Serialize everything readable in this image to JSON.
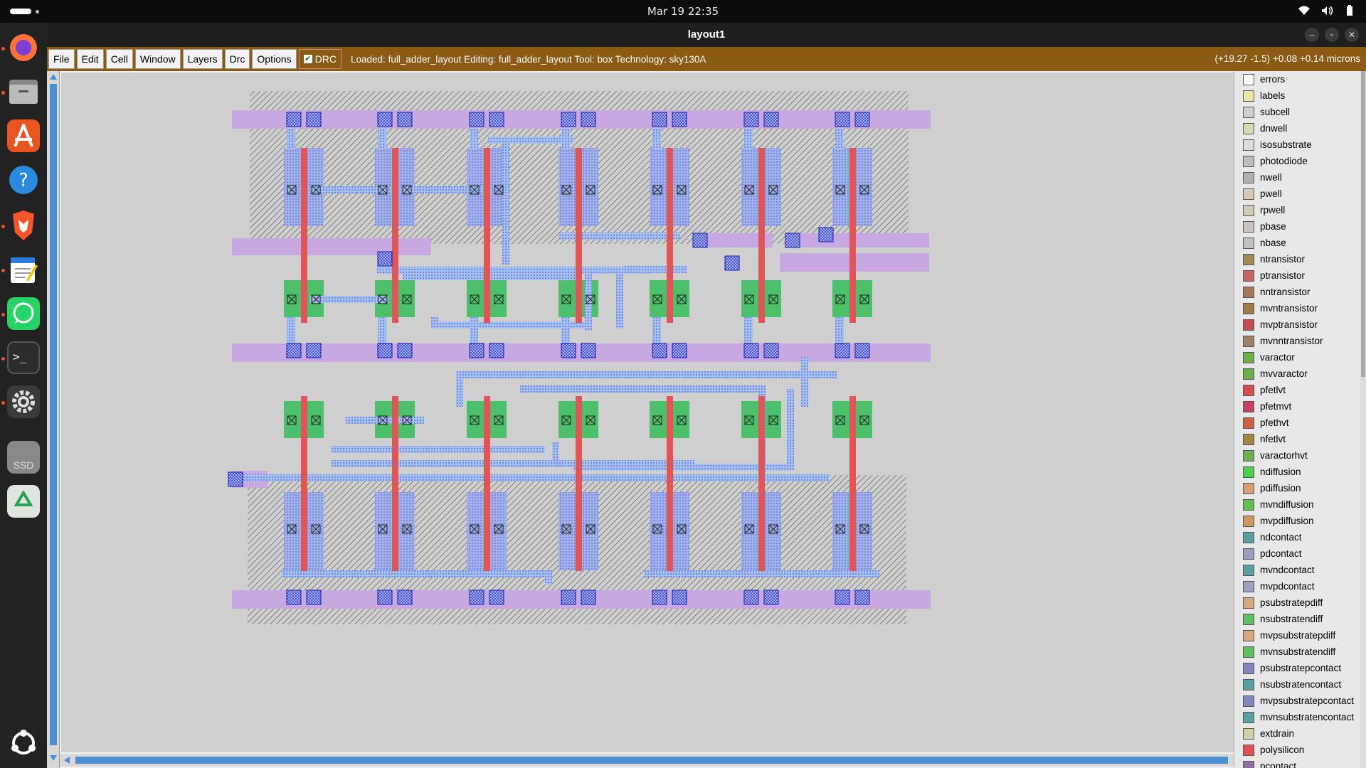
{
  "topbar": {
    "clock": "Mar 19  22:35"
  },
  "window": {
    "title": "layout1",
    "min": "–",
    "max": "▫",
    "close": "✕"
  },
  "menu": {
    "items": [
      "File",
      "Edit",
      "Cell",
      "Window",
      "Layers",
      "Drc",
      "Options"
    ],
    "drc_label": "DRC",
    "status": "Loaded: full_adder_layout  Editing: full_adder_layout  Tool: box   Technology: sky130A",
    "coords": "(+19.27 -1.5) +0.08 +0.14 microns"
  },
  "dock": {
    "ssd": "SSD"
  },
  "legend": [
    {
      "name": "errors",
      "color": "#ffffff"
    },
    {
      "name": "labels",
      "color": "#e8e6a0"
    },
    {
      "name": "subcell",
      "color": "#d0d0d0"
    },
    {
      "name": "dnwell",
      "color": "#d9d9b0"
    },
    {
      "name": "isosubstrate",
      "color": "#dcdcdc"
    },
    {
      "name": "photodiode",
      "color": "#bdbdbd"
    },
    {
      "name": "nwell",
      "color": "#b0b0b0"
    },
    {
      "name": "pwell",
      "color": "#d8c8b8"
    },
    {
      "name": "rpwell",
      "color": "#d8c8b8"
    },
    {
      "name": "pbase",
      "color": "#d0c0c0"
    },
    {
      "name": "nbase",
      "color": "#c0c0c0"
    },
    {
      "name": "ntransistor",
      "color": "#a08c5a"
    },
    {
      "name": "ptransistor",
      "color": "#c86464"
    },
    {
      "name": "nntransistor",
      "color": "#a07a5a"
    },
    {
      "name": "mvntransistor",
      "color": "#a07a4a"
    },
    {
      "name": "mvptransistor",
      "color": "#c05050"
    },
    {
      "name": "mvnntransistor",
      "color": "#a08060"
    },
    {
      "name": "varactor",
      "color": "#6ab04a"
    },
    {
      "name": "mvvaractor",
      "color": "#6ab04a"
    },
    {
      "name": "pfetlvt",
      "color": "#d05050"
    },
    {
      "name": "pfetmvt",
      "color": "#c84060"
    },
    {
      "name": "pfethvt",
      "color": "#d06040"
    },
    {
      "name": "nfetlvt",
      "color": "#a08840"
    },
    {
      "name": "varactorhvt",
      "color": "#70b050"
    },
    {
      "name": "ndiffusion",
      "color": "#4ad04a"
    },
    {
      "name": "pdiffusion",
      "color": "#d8a070"
    },
    {
      "name": "mvndiffusion",
      "color": "#60c050"
    },
    {
      "name": "mvpdiffusion",
      "color": "#d09860"
    },
    {
      "name": "ndcontact",
      "color": "#5aa0a0"
    },
    {
      "name": "pdcontact",
      "color": "#9aa0c0"
    },
    {
      "name": "mvndcontact",
      "color": "#5aa0a0"
    },
    {
      "name": "mvpdcontact",
      "color": "#9aa0c0"
    },
    {
      "name": "psubstratepdiff",
      "color": "#d8a878"
    },
    {
      "name": "nsubstratendiff",
      "color": "#60c060"
    },
    {
      "name": "mvpsubstratepdiff",
      "color": "#d8a878"
    },
    {
      "name": "mvnsubstratendiff",
      "color": "#60c060"
    },
    {
      "name": "psubstratepcontact",
      "color": "#8088c0"
    },
    {
      "name": "nsubstratencontact",
      "color": "#5aa0a0"
    },
    {
      "name": "mvpsubstratepcontact",
      "color": "#8088c0"
    },
    {
      "name": "mvnsubstratencontact",
      "color": "#5aa0a0"
    },
    {
      "name": "extdrain",
      "color": "#d0d0a0"
    },
    {
      "name": "polysilicon",
      "color": "#e05050"
    },
    {
      "name": "pcontact",
      "color": "#9070a0"
    }
  ],
  "colors": {
    "poly": "#e05656",
    "metal1": "#8ab0f0",
    "li": "#aab0ec",
    "ndiff": "#4cc06a",
    "rail": "#c8a8e0",
    "contact": "#2a3ae0"
  }
}
